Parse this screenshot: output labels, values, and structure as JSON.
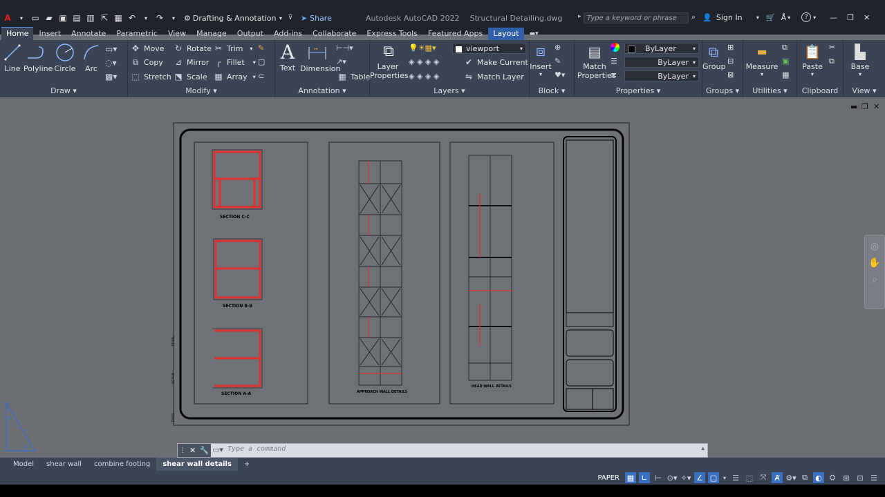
{
  "titlebar": {
    "app_title": "Autodesk AutoCAD 2022",
    "file_name": "Structural Detailing.dwg",
    "workspace": "Drafting & Annotation",
    "share_label": "Share",
    "search_placeholder": "Type a keyword or phrase",
    "sign_in_label": "Sign In"
  },
  "tabs": [
    "Home",
    "Insert",
    "Annotate",
    "Parametric",
    "View",
    "Manage",
    "Output",
    "Add-ins",
    "Collaborate",
    "Express Tools",
    "Featured Apps",
    "Layout"
  ],
  "ribbon": {
    "draw": {
      "title": "Draw",
      "line": "Line",
      "polyline": "Polyline",
      "circle": "Circle",
      "arc": "Arc"
    },
    "modify": {
      "title": "Modify",
      "move": "Move",
      "rotate": "Rotate",
      "trim": "Trim",
      "copy": "Copy",
      "mirror": "Mirror",
      "fillet": "Fillet",
      "stretch": "Stretch",
      "scale": "Scale",
      "array": "Array"
    },
    "annotation": {
      "title": "Annotation",
      "text": "Text",
      "dimension": "Dimension",
      "table": "Table"
    },
    "layers": {
      "title": "Layers",
      "layer_properties": "Layer Properties",
      "current_layer": "viewport",
      "make_current": "Make Current",
      "match_layer": "Match Layer"
    },
    "block": {
      "title": "Block",
      "insert": "Insert"
    },
    "properties": {
      "title": "Properties",
      "match_properties": "Match Properties",
      "color": "ByLayer",
      "linetype": "ByLayer",
      "lineweight": "ByLayer"
    },
    "groups": {
      "title": "Groups",
      "group": "Group"
    },
    "utilities": {
      "title": "Utilities",
      "measure": "Measure"
    },
    "clipboard": {
      "title": "Clipboard",
      "paste": "Paste"
    },
    "view": {
      "title": "View",
      "base": "Base"
    }
  },
  "drawing": {
    "section_cc": "SECTION C-C",
    "section_bb": "SECTION B-B",
    "section_aa": "SECTION A-A",
    "approach_wall": "APPROACH WALL DETAILS",
    "head_wall": "HEAD WALL DETAILS"
  },
  "command": {
    "placeholder": "Type a command"
  },
  "layout_tabs": {
    "items": [
      "Model",
      "shear wall",
      "combine footing",
      "shear wall details"
    ],
    "active": "shear wall details"
  },
  "status": {
    "space": "PAPER"
  },
  "colors": {
    "accent": "#3a70c2",
    "ribbon": "#3b4455",
    "rebar": "#e03030"
  }
}
